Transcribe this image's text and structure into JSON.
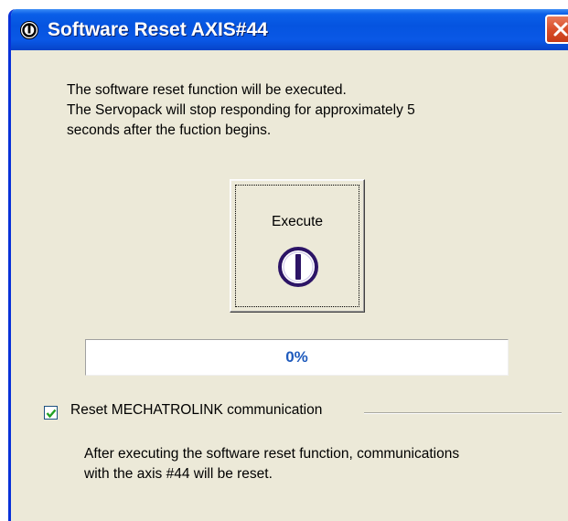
{
  "window": {
    "title": "Software Reset AXIS#44",
    "colors": {
      "titlebar": "#0554e0",
      "close": "#d94f2a",
      "face": "#ece9d8",
      "progress_text": "#1f5bbd"
    }
  },
  "message": {
    "lines": [
      "The software reset function will be executed.",
      "The Servopack will stop responding for approximately 5",
      "seconds after the fuction begins."
    ]
  },
  "execute": {
    "label": "Execute",
    "icon": "power-icon"
  },
  "progress": {
    "percent": 0,
    "text": "0%"
  },
  "reset_option": {
    "checked": true,
    "label": "Reset MECHATROLINK communication",
    "description": [
      "After executing the software reset function, communications",
      "with the axis #44 will be reset."
    ]
  }
}
